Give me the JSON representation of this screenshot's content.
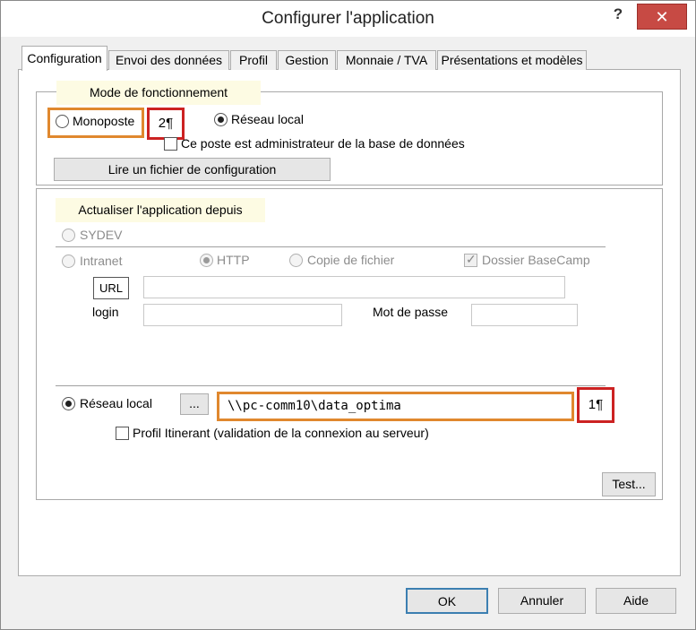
{
  "window": {
    "title": "Configurer l'application",
    "help_label": "?",
    "close_label": "✕"
  },
  "tabs": [
    {
      "label": "Configuration"
    },
    {
      "label": "Envoi des données"
    },
    {
      "label": "Profil"
    },
    {
      "label": "Gestion"
    },
    {
      "label": "Monnaie / TVA"
    },
    {
      "label": "Présentations et modèles"
    }
  ],
  "mode": {
    "legend": "Mode de fonctionnement",
    "monoposte_label": "Monoposte",
    "monoposte_selected": false,
    "reseau_label": "Réseau local",
    "reseau_selected": true,
    "admin_label": "Ce poste est administrateur de la base de données",
    "admin_checked": false,
    "read_config_label": "Lire un fichier de configuration"
  },
  "update": {
    "legend": "Actualiser l'application depuis",
    "sydev_label": "SYDEV",
    "intranet_label": "Intranet",
    "http_label": "HTTP",
    "copie_label": "Copie de fichier",
    "dossier_label": "Dossier BaseCamp",
    "url_label": "URL",
    "url_value": "",
    "login_label": "login",
    "login_value": "",
    "password_label": "Mot de passe",
    "password_value": "",
    "reseau_label": "Réseau local",
    "browse_label": "...",
    "path_value": "\\\\pc-comm10\\data_optima",
    "profil_label": "Profil Itinerant (validation de la connexion au serveur)",
    "test_label": "Test..."
  },
  "annotations": {
    "marker_1": "1¶",
    "marker_2": "2¶",
    "highlight_color": "#e0882e",
    "marker_color": "#cc2222"
  },
  "footer": {
    "ok_label": "OK",
    "cancel_label": "Annuler",
    "help_label": "Aide"
  }
}
